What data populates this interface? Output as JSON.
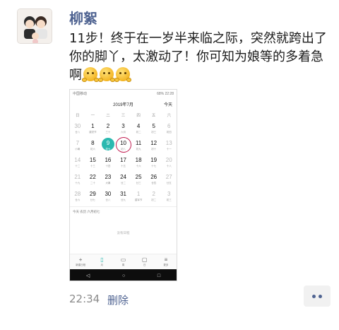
{
  "post": {
    "author": "柳絮",
    "text": "11步！终于在一岁半来临之际，突然就跨出了你的脚丫，太激动了！你可知为娘等的多着急啊",
    "emojis": [
      "hands-emoji",
      "hands-emoji",
      "hands-emoji"
    ],
    "time": "22:34",
    "delete_label": "删除"
  },
  "screenshot": {
    "status_left": "中国移动",
    "status_right": "68%  22:28",
    "month": "2019年7月",
    "today_label": "今天",
    "weekdays": [
      "日",
      "一",
      "二",
      "三",
      "四",
      "五",
      "六"
    ],
    "weeks": [
      [
        {
          "n": "30",
          "l": "廿八",
          "muted": true
        },
        {
          "n": "1",
          "l": "建党节"
        },
        {
          "n": "2",
          "l": "三十"
        },
        {
          "n": "3",
          "l": "六月"
        },
        {
          "n": "4",
          "l": "初二"
        },
        {
          "n": "5",
          "l": "初三"
        },
        {
          "n": "6",
          "l": "初四",
          "weekend": true
        }
      ],
      [
        {
          "n": "7",
          "l": "小暑",
          "weekend": true
        },
        {
          "n": "8",
          "l": "初六"
        },
        {
          "n": "9",
          "l": "初七",
          "sel": true
        },
        {
          "n": "10",
          "l": "初八",
          "ring": true
        },
        {
          "n": "11",
          "l": "初九"
        },
        {
          "n": "12",
          "l": "初十"
        },
        {
          "n": "13",
          "l": "十一",
          "weekend": true
        }
      ],
      [
        {
          "n": "14",
          "l": "十二",
          "weekend": true
        },
        {
          "n": "15",
          "l": "十三"
        },
        {
          "n": "16",
          "l": "十四"
        },
        {
          "n": "17",
          "l": "十五"
        },
        {
          "n": "18",
          "l": "十六"
        },
        {
          "n": "19",
          "l": "十七"
        },
        {
          "n": "20",
          "l": "十八",
          "weekend": true
        }
      ],
      [
        {
          "n": "21",
          "l": "十九",
          "weekend": true
        },
        {
          "n": "22",
          "l": "二十"
        },
        {
          "n": "23",
          "l": "大暑"
        },
        {
          "n": "24",
          "l": "廿二"
        },
        {
          "n": "25",
          "l": "廿三"
        },
        {
          "n": "26",
          "l": "廿四"
        },
        {
          "n": "27",
          "l": "廿五",
          "weekend": true
        }
      ],
      [
        {
          "n": "28",
          "l": "廿六",
          "weekend": true
        },
        {
          "n": "29",
          "l": "廿七"
        },
        {
          "n": "30",
          "l": "廿八"
        },
        {
          "n": "31",
          "l": "廿九"
        },
        {
          "n": "1",
          "l": "建军节",
          "muted": true
        },
        {
          "n": "2",
          "l": "初二",
          "muted": true
        },
        {
          "n": "3",
          "l": "初三",
          "muted": true
        }
      ]
    ],
    "lunar_line": "今天 农历 六月初七",
    "no_event": "没有日程",
    "tabs": [
      {
        "icon": "+",
        "label": "新建日程"
      },
      {
        "icon": "▯",
        "label": "月",
        "active": true
      },
      {
        "icon": "▭",
        "label": "周"
      },
      {
        "icon": "▢",
        "label": "日"
      },
      {
        "icon": "≡",
        "label": "更多"
      }
    ],
    "nav": [
      "◁",
      "○",
      "□"
    ]
  },
  "colors": {
    "accent": "#2bb9b0",
    "ring": "#c21e52",
    "link": "#4f6391"
  }
}
